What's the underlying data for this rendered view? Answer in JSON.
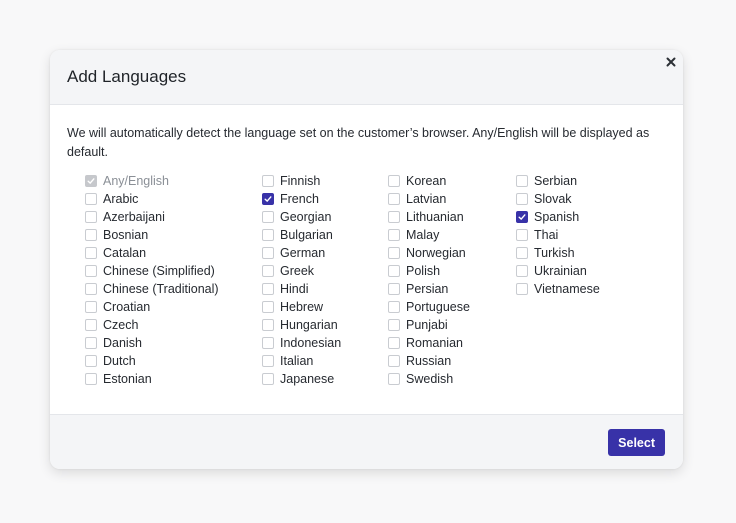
{
  "modal": {
    "title": "Add Languages",
    "close_icon": "close-icon",
    "description": "We will automatically detect the language set on the customer’s browser. Any/English will be displayed as default.",
    "accent_color": "#3832a8",
    "columns": [
      [
        {
          "label": "Any/English",
          "checked": true,
          "disabled": true
        },
        {
          "label": "Arabic",
          "checked": false,
          "disabled": false
        },
        {
          "label": "Azerbaijani",
          "checked": false,
          "disabled": false
        },
        {
          "label": "Bosnian",
          "checked": false,
          "disabled": false
        },
        {
          "label": "Catalan",
          "checked": false,
          "disabled": false
        },
        {
          "label": "Chinese (Simplified)",
          "checked": false,
          "disabled": false
        },
        {
          "label": "Chinese (Traditional)",
          "checked": false,
          "disabled": false
        },
        {
          "label": "Croatian",
          "checked": false,
          "disabled": false
        },
        {
          "label": "Czech",
          "checked": false,
          "disabled": false
        },
        {
          "label": "Danish",
          "checked": false,
          "disabled": false
        },
        {
          "label": "Dutch",
          "checked": false,
          "disabled": false
        },
        {
          "label": "Estonian",
          "checked": false,
          "disabled": false
        }
      ],
      [
        {
          "label": "Finnish",
          "checked": false,
          "disabled": false
        },
        {
          "label": "French",
          "checked": true,
          "disabled": false
        },
        {
          "label": "Georgian",
          "checked": false,
          "disabled": false
        },
        {
          "label": "Bulgarian",
          "checked": false,
          "disabled": false
        },
        {
          "label": "German",
          "checked": false,
          "disabled": false
        },
        {
          "label": "Greek",
          "checked": false,
          "disabled": false
        },
        {
          "label": "Hindi",
          "checked": false,
          "disabled": false
        },
        {
          "label": "Hebrew",
          "checked": false,
          "disabled": false
        },
        {
          "label": "Hungarian",
          "checked": false,
          "disabled": false
        },
        {
          "label": "Indonesian",
          "checked": false,
          "disabled": false
        },
        {
          "label": "Italian",
          "checked": false,
          "disabled": false
        },
        {
          "label": "Japanese",
          "checked": false,
          "disabled": false
        }
      ],
      [
        {
          "label": "Korean",
          "checked": false,
          "disabled": false
        },
        {
          "label": "Latvian",
          "checked": false,
          "disabled": false
        },
        {
          "label": "Lithuanian",
          "checked": false,
          "disabled": false
        },
        {
          "label": "Malay",
          "checked": false,
          "disabled": false
        },
        {
          "label": "Norwegian",
          "checked": false,
          "disabled": false
        },
        {
          "label": "Polish",
          "checked": false,
          "disabled": false
        },
        {
          "label": "Persian",
          "checked": false,
          "disabled": false
        },
        {
          "label": "Portuguese",
          "checked": false,
          "disabled": false
        },
        {
          "label": "Punjabi",
          "checked": false,
          "disabled": false
        },
        {
          "label": "Romanian",
          "checked": false,
          "disabled": false
        },
        {
          "label": "Russian",
          "checked": false,
          "disabled": false
        },
        {
          "label": "Swedish",
          "checked": false,
          "disabled": false
        }
      ],
      [
        {
          "label": "Serbian",
          "checked": false,
          "disabled": false
        },
        {
          "label": "Slovak",
          "checked": false,
          "disabled": false
        },
        {
          "label": "Spanish",
          "checked": true,
          "disabled": false
        },
        {
          "label": "Thai",
          "checked": false,
          "disabled": false
        },
        {
          "label": "Turkish",
          "checked": false,
          "disabled": false
        },
        {
          "label": "Ukrainian",
          "checked": false,
          "disabled": false
        },
        {
          "label": "Vietnamese",
          "checked": false,
          "disabled": false
        }
      ]
    ],
    "footer": {
      "select_label": "Select"
    }
  }
}
